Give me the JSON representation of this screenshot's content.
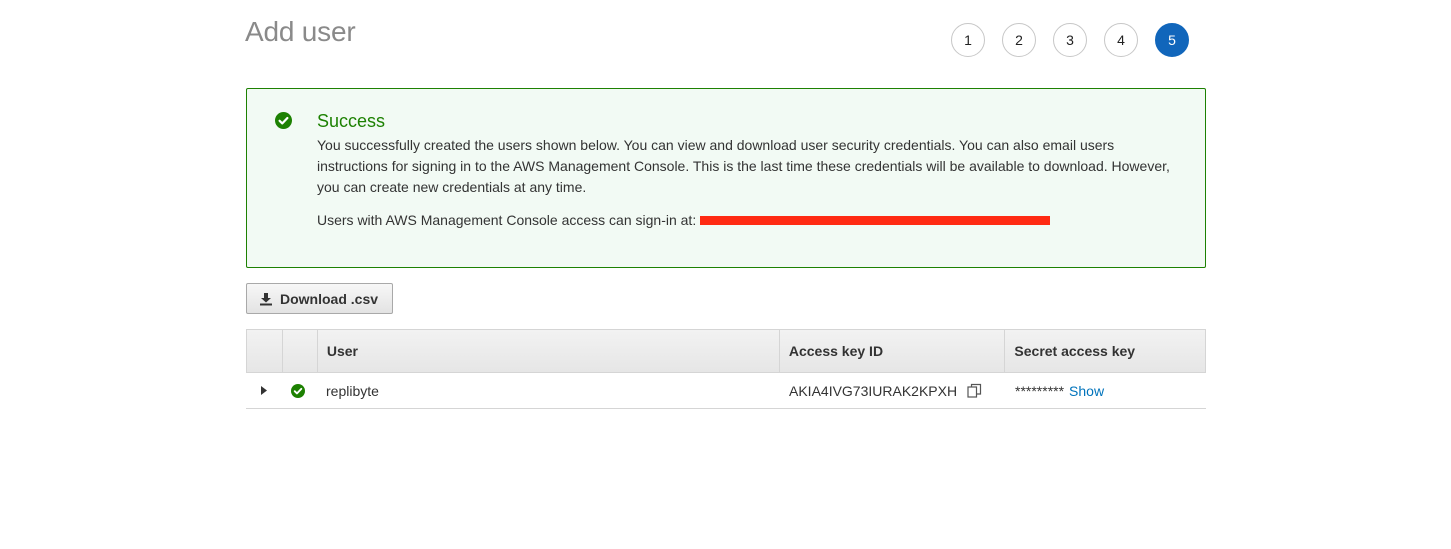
{
  "page": {
    "title": "Add user"
  },
  "steps": [
    "1",
    "2",
    "3",
    "4",
    "5"
  ],
  "active_step": "5",
  "alert": {
    "title": "Success",
    "body": "You successfully created the users shown below. You can view and download user security credentials. You can also email users instructions for signing in to the AWS Management Console. This is the last time these credentials will be available to download. However, you can create new credentials at any time.",
    "signin_label": "Users with AWS Management Console access can sign-in at:"
  },
  "toolbar": {
    "download_label": "Download .csv"
  },
  "table": {
    "headers": {
      "user": "User",
      "access_key_id": "Access key ID",
      "secret_access_key": "Secret access key"
    },
    "rows": [
      {
        "user": "replibyte",
        "access_key_id": "AKIA4IVG73IURAK2KPXH",
        "secret_masked": "*********",
        "show_label": "Show"
      }
    ]
  },
  "colors": {
    "success": "#1d8102",
    "accent": "#1166bb",
    "link": "#0073bb"
  }
}
